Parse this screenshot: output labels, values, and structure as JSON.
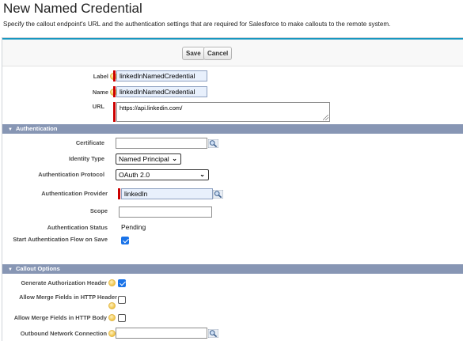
{
  "page": {
    "title": "New Named Credential",
    "description": "Specify the callout endpoint's URL and the authentication settings that are required for Salesforce to make callouts to the remote system."
  },
  "buttons": {
    "save": "Save",
    "cancel": "Cancel"
  },
  "fields": {
    "label": {
      "label": "Label",
      "value": "linkedInNamedCredential"
    },
    "name": {
      "label": "Name",
      "value": "linkedInNamedCredential"
    },
    "url": {
      "label": "URL",
      "value": "https://api.linkedin.com/"
    }
  },
  "auth": {
    "section_title": "Authentication",
    "certificate": {
      "label": "Certificate",
      "value": ""
    },
    "identity_type": {
      "label": "Identity Type",
      "value": "Named Principal"
    },
    "auth_protocol": {
      "label": "Authentication Protocol",
      "value": "OAuth 2.0"
    },
    "auth_provider": {
      "label": "Authentication Provider",
      "value": "linkedIn"
    },
    "scope": {
      "label": "Scope",
      "value": ""
    },
    "auth_status": {
      "label": "Authentication Status",
      "value": "Pending"
    },
    "start_flow": {
      "label": "Start Authentication Flow on Save",
      "checked": true
    }
  },
  "callout": {
    "section_title": "Callout Options",
    "gen_auth_header": {
      "label": "Generate Authorization Header",
      "checked": true
    },
    "merge_header": {
      "label": "Allow Merge Fields in HTTP Header",
      "checked": false
    },
    "merge_body": {
      "label": "Allow Merge Fields in HTTP Body",
      "checked": false
    },
    "outbound": {
      "label": "Outbound Network Connection",
      "value": ""
    }
  },
  "icons": {
    "help": "help-icon",
    "lookup": "lookup-magnifier-icon",
    "collapse": "triangle-down-icon"
  },
  "colors": {
    "section_header": "#8796b4",
    "required_bar": "#cc0000",
    "autofill_bg": "#e8f0fc",
    "checkbox_on": "#1a73e8",
    "top_accent": "#1797c0"
  }
}
